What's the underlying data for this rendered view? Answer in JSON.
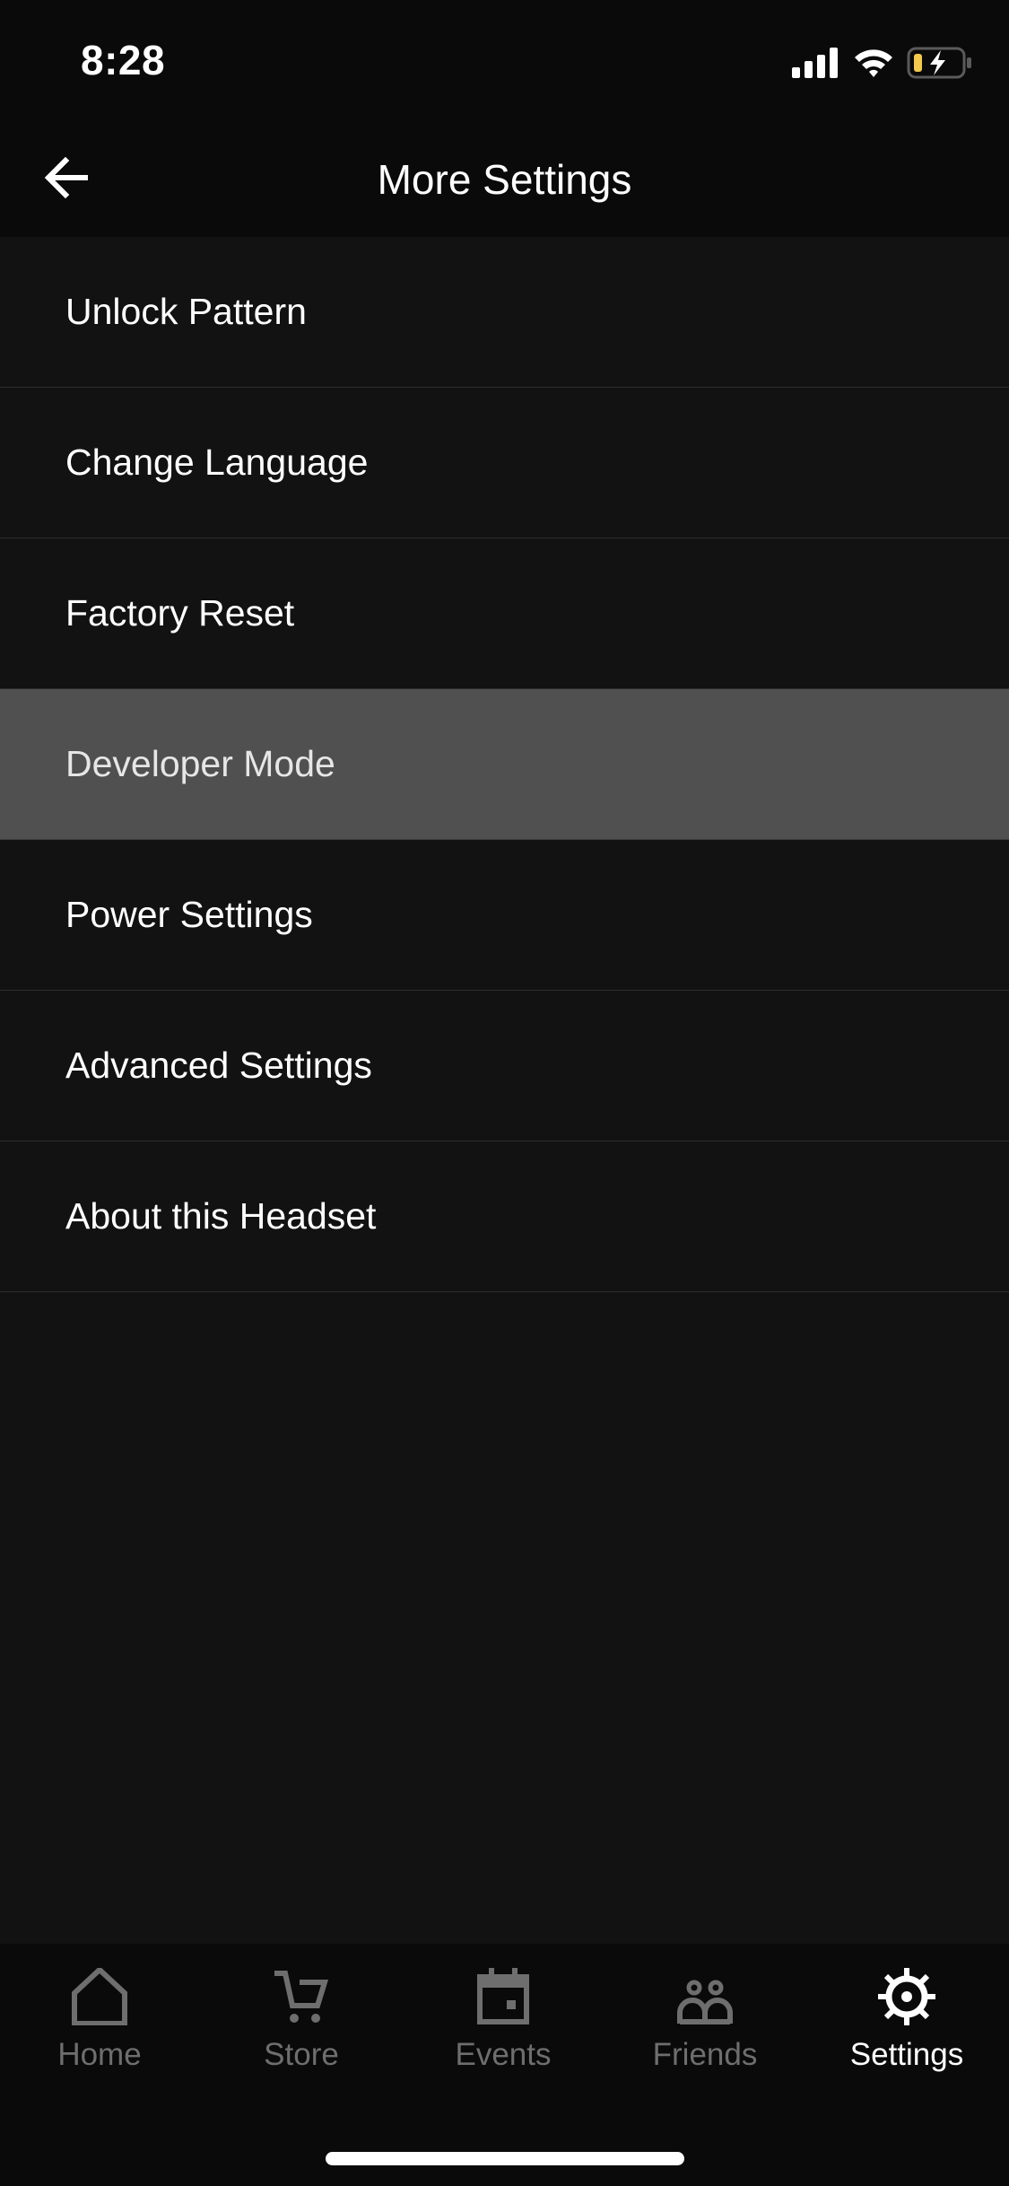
{
  "status_bar": {
    "time": "8:28",
    "icons": [
      "signal-icon",
      "wifi-icon",
      "battery-charging-icon"
    ],
    "battery_color": "#f2c94c"
  },
  "header": {
    "back_icon": "arrow-left-icon",
    "title": "More Settings"
  },
  "menu": {
    "items": [
      {
        "label": "Unlock Pattern",
        "selected": false
      },
      {
        "label": "Change Language",
        "selected": false
      },
      {
        "label": "Factory Reset",
        "selected": false
      },
      {
        "label": "Developer Mode",
        "selected": true
      },
      {
        "label": "Power Settings",
        "selected": false
      },
      {
        "label": "Advanced Settings",
        "selected": false
      },
      {
        "label": "About this Headset",
        "selected": false
      }
    ]
  },
  "tabbar": {
    "tabs": [
      {
        "label": "Home",
        "icon": "home-icon",
        "active": false
      },
      {
        "label": "Store",
        "icon": "cart-icon",
        "active": false
      },
      {
        "label": "Events",
        "icon": "calendar-icon",
        "active": false
      },
      {
        "label": "Friends",
        "icon": "friends-icon",
        "active": false
      },
      {
        "label": "Settings",
        "icon": "gear-icon",
        "active": true
      }
    ],
    "active_color": "#ffffff",
    "inactive_color": "#6e6e6e"
  }
}
